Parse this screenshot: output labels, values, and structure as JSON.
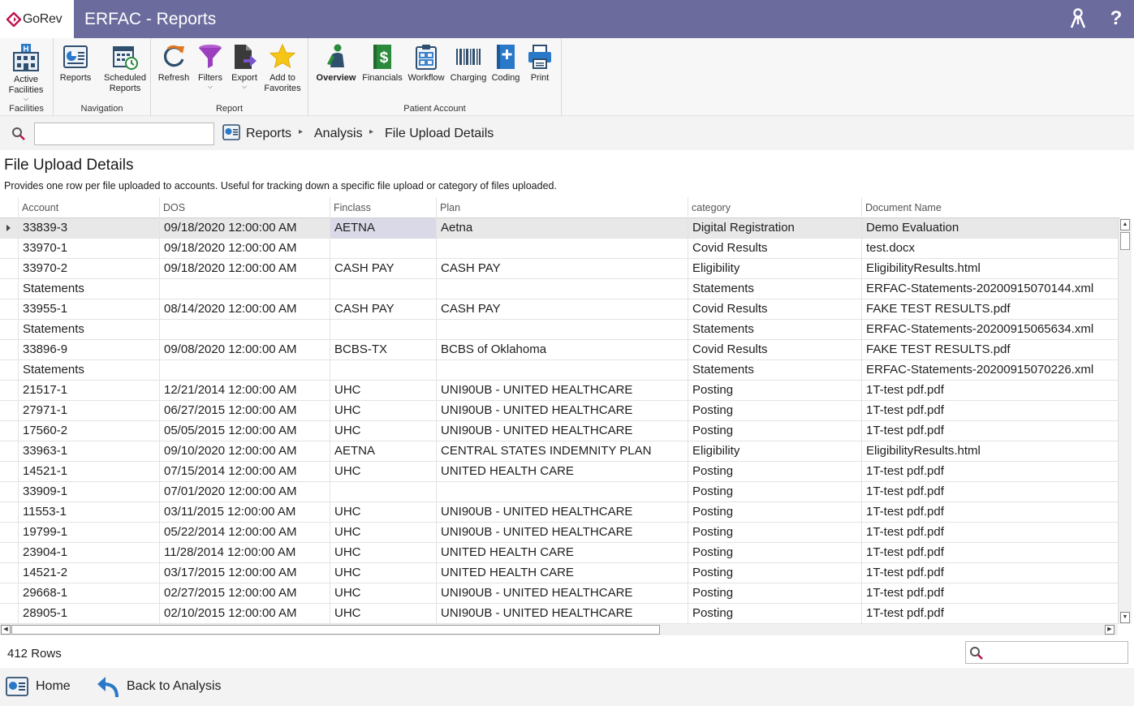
{
  "titlebar": {
    "logo_text": "GoRev",
    "title": "ERFAC - Reports",
    "icons": [
      "user-keys-icon",
      "help-icon"
    ],
    "help_glyph": "?",
    "bg_color": "#6b6b9e"
  },
  "ribbon": {
    "groups": [
      {
        "label": "Facilities",
        "buttons": [
          {
            "label": "Active Facilities",
            "icon": "hospital-building-icon",
            "dropdown": true
          }
        ]
      },
      {
        "label": "Navigation",
        "buttons": [
          {
            "label": "Reports",
            "icon": "reports-icon"
          },
          {
            "label": "Scheduled Reports",
            "icon": "calendar-clock-icon"
          }
        ]
      },
      {
        "label": "Report",
        "buttons": [
          {
            "label": "Refresh",
            "icon": "refresh-icon"
          },
          {
            "label": "Filters",
            "icon": "funnel-icon",
            "dropdown": true
          },
          {
            "label": "Export",
            "icon": "export-icon",
            "dropdown": true
          },
          {
            "label": "Add to Favorites",
            "icon": "star-icon"
          }
        ]
      },
      {
        "label": "Patient Account",
        "buttons": [
          {
            "label": "Overview",
            "icon": "person-icon",
            "bold": true
          },
          {
            "label": "Financials",
            "icon": "dollar-book-icon"
          },
          {
            "label": "Workflow",
            "icon": "clipboard-icon"
          },
          {
            "label": "Charging",
            "icon": "barcode-icon"
          },
          {
            "label": "Coding",
            "icon": "coding-book-icon"
          },
          {
            "label": "Print",
            "icon": "printer-icon"
          }
        ]
      }
    ]
  },
  "crumbs": {
    "search_value": "",
    "items": [
      "Reports",
      "Analysis",
      "File Upload Details"
    ]
  },
  "page": {
    "title": "File Upload Details",
    "description": "Provides one row per file uploaded to accounts.  Useful for tracking down a specific file upload or category of files uploaded."
  },
  "grid": {
    "columns": [
      "Account",
      "DOS",
      "Finclass",
      "Plan",
      "category",
      "Document Name"
    ],
    "rows": [
      [
        "33839-3",
        "09/18/2020 12:00:00 AM",
        "AETNA",
        "Aetna",
        "Digital Registration",
        "Demo Evaluation"
      ],
      [
        "33970-1",
        "09/18/2020 12:00:00 AM",
        "",
        "",
        "Covid Results",
        "test.docx"
      ],
      [
        "33970-2",
        "09/18/2020 12:00:00 AM",
        "CASH PAY",
        "CASH PAY",
        "Eligibility",
        "EligibilityResults.html"
      ],
      [
        "Statements",
        "",
        "",
        "",
        "Statements",
        "ERFAC-Statements-20200915070144.xml"
      ],
      [
        "33955-1",
        "08/14/2020 12:00:00 AM",
        "CASH PAY",
        "CASH PAY",
        "Covid Results",
        "FAKE TEST RESULTS.pdf"
      ],
      [
        "Statements",
        "",
        "",
        "",
        "Statements",
        "ERFAC-Statements-20200915065634.xml"
      ],
      [
        "33896-9",
        "09/08/2020 12:00:00 AM",
        "BCBS-TX",
        "BCBS of Oklahoma",
        "Covid Results",
        "FAKE TEST RESULTS.pdf"
      ],
      [
        "Statements",
        "",
        "",
        "",
        "Statements",
        "ERFAC-Statements-20200915070226.xml"
      ],
      [
        "21517-1",
        "12/21/2014 12:00:00 AM",
        "UHC",
        "UNI90UB - UNITED HEALTHCARE",
        "Posting",
        "1T-test pdf.pdf"
      ],
      [
        "27971-1",
        "06/27/2015 12:00:00 AM",
        "UHC",
        "UNI90UB - UNITED HEALTHCARE",
        "Posting",
        "1T-test pdf.pdf"
      ],
      [
        "17560-2",
        "05/05/2015 12:00:00 AM",
        "UHC",
        "UNI90UB - UNITED HEALTHCARE",
        "Posting",
        "1T-test pdf.pdf"
      ],
      [
        "33963-1",
        "09/10/2020 12:00:00 AM",
        "AETNA",
        "CENTRAL STATES INDEMNITY PLAN",
        "Eligibility",
        "EligibilityResults.html"
      ],
      [
        "14521-1",
        "07/15/2014 12:00:00 AM",
        "UHC",
        "UNITED HEALTH CARE",
        "Posting",
        "1T-test pdf.pdf"
      ],
      [
        "33909-1",
        "07/01/2020 12:00:00 AM",
        "",
        "",
        "Posting",
        "1T-test pdf.pdf"
      ],
      [
        "11553-1",
        "03/11/2015 12:00:00 AM",
        "UHC",
        "UNI90UB - UNITED HEALTHCARE",
        "Posting",
        "1T-test pdf.pdf"
      ],
      [
        "19799-1",
        "05/22/2014 12:00:00 AM",
        "UHC",
        "UNI90UB - UNITED HEALTHCARE",
        "Posting",
        "1T-test pdf.pdf"
      ],
      [
        "23904-1",
        "11/28/2014 12:00:00 AM",
        "UHC",
        "UNITED HEALTH CARE",
        "Posting",
        "1T-test pdf.pdf"
      ],
      [
        "14521-2",
        "03/17/2015 12:00:00 AM",
        "UHC",
        "UNITED HEALTH CARE",
        "Posting",
        "1T-test pdf.pdf"
      ],
      [
        "29668-1",
        "02/27/2015 12:00:00 AM",
        "UHC",
        "UNI90UB - UNITED HEALTHCARE",
        "Posting",
        "1T-test pdf.pdf"
      ],
      [
        "28905-1",
        "02/10/2015 12:00:00 AM",
        "UHC",
        "UNI90UB - UNITED HEALTHCARE",
        "Posting",
        "1T-test pdf.pdf"
      ]
    ],
    "selected_row": 0,
    "row_count_label": "412 Rows",
    "footer_search_value": ""
  },
  "bottom": {
    "home_label": "Home",
    "back_label": "Back to Analysis"
  }
}
